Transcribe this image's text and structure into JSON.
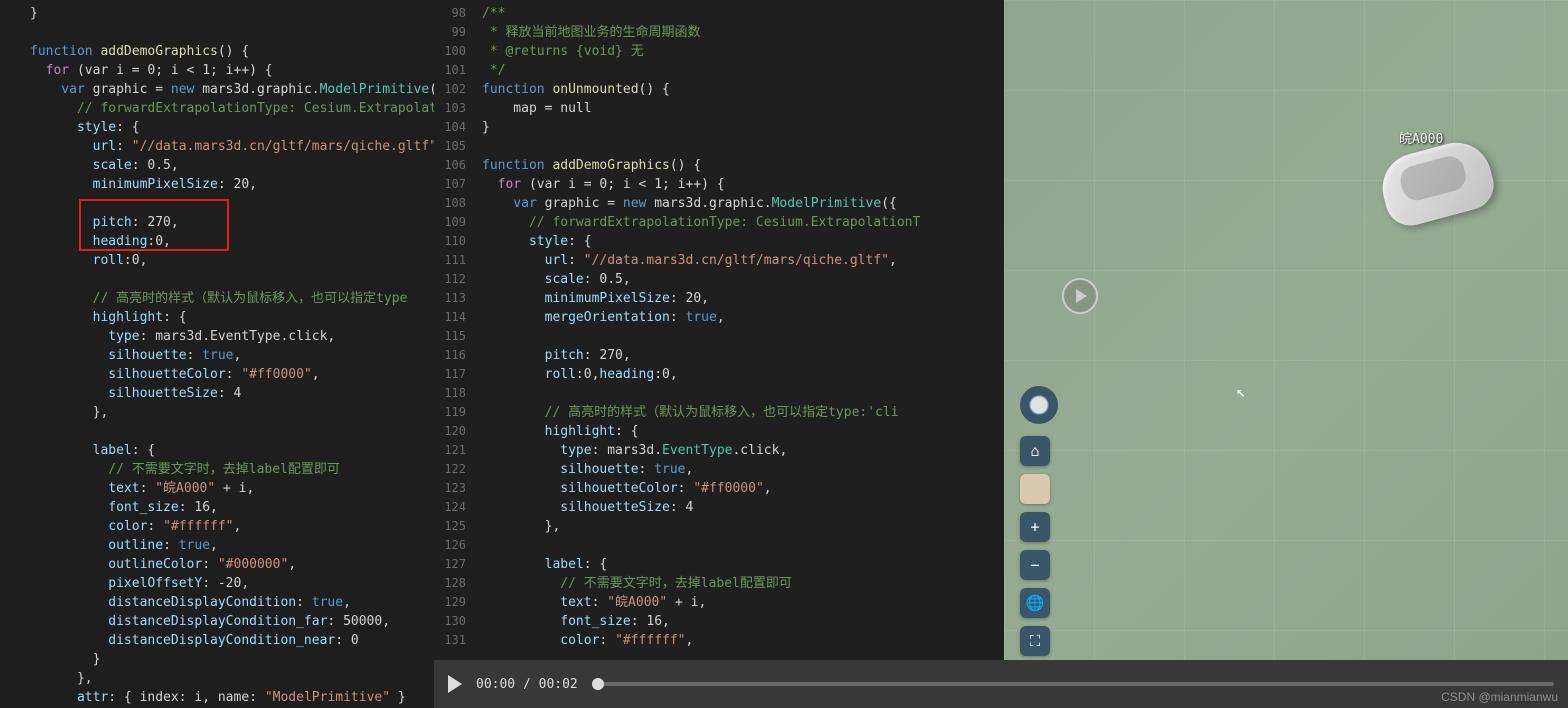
{
  "leftCode": {
    "l1": "}",
    "l2": "",
    "l3_kw": "function",
    "l3_fn": " addDemoGraphics",
    "l3_rest": "() {",
    "l4_for": "  for",
    "l4_rest": " (var i = 0; i < 1; i++) {",
    "l5_var": "    var",
    "l5_g": " graphic = ",
    "l5_new": "new",
    "l5_m": " mars3d.graphic.",
    "l5_t": "ModelPrimitive",
    "l5_p": "(",
    "l6": "      // forwardExtrapolationType: Cesium.Extrapolat",
    "l7_p": "      style",
    "l7_r": ": {",
    "l8_p": "        url",
    "l8_c": ": ",
    "l8_s": "\"//data.mars3d.cn/gltf/mars/qiche.gltf\"",
    "l9_p": "        scale",
    "l9_r": ": 0.5,",
    "l10_p": "        minimumPixelSize",
    "l10_r": ": 20,",
    "l11": "",
    "l12_p": "        pitch",
    "l12_r": ": 270,",
    "l13_p": "        heading",
    "l13_r": ":0,",
    "l14_p": "        roll",
    "l14_r": ":0,",
    "l15": "",
    "l16": "        // 高亮时的样式（默认为鼠标移入，也可以指定type",
    "l17_p": "        highlight",
    "l17_r": ": {",
    "l18_p": "          type",
    "l18_r": ": mars3d.EventType.click,",
    "l19_p": "          silhouette",
    "l19_c": ": ",
    "l19_v": "true",
    "l19_e": ",",
    "l20_p": "          silhouetteColor",
    "l20_c": ": ",
    "l20_s": "\"#ff0000\"",
    "l20_e": ",",
    "l21_p": "          silhouetteSize",
    "l21_r": ": 4",
    "l22": "        },",
    "l23": "",
    "l24_p": "        label",
    "l24_r": ": {",
    "l25": "          // 不需要文字时，去掉label配置即可",
    "l26_p": "          text",
    "l26_c": ": ",
    "l26_s": "\"皖A000\"",
    "l26_r": " + i,",
    "l27_p": "          font_size",
    "l27_r": ": 16,",
    "l28_p": "          color",
    "l28_c": ": ",
    "l28_s": "\"#ffffff\"",
    "l28_e": ",",
    "l29_p": "          outline",
    "l29_c": ": ",
    "l29_v": "true",
    "l29_e": ",",
    "l30_p": "          outlineColor",
    "l30_c": ": ",
    "l30_s": "\"#000000\"",
    "l30_e": ",",
    "l31_p": "          pixelOffsetY",
    "l31_r": ": -20,",
    "l32_p": "          distanceDisplayCondition",
    "l32_c": ": ",
    "l32_v": "true",
    "l32_e": ",",
    "l33_p": "          distanceDisplayCondition_far",
    "l33_r": ": 50000,",
    "l34_p": "          distanceDisplayCondition_near",
    "l34_r": ": 0",
    "l35": "        }",
    "l36": "      },",
    "l37_p": "      attr",
    "l37_r": ": { index: i, name: ",
    "l37_s": "\"ModelPrimitive\"",
    "l37_e": " }"
  },
  "lineNumbers": [
    "98",
    "99",
    "100",
    "101",
    "102",
    "103",
    "104",
    "105",
    "106",
    "107",
    "108",
    "109",
    "110",
    "111",
    "112",
    "113",
    "114",
    "115",
    "116",
    "117",
    "118",
    "119",
    "120",
    "121",
    "122",
    "123",
    "124",
    "125",
    "126",
    "127",
    "128",
    "129",
    "130",
    "131"
  ],
  "rightCode": {
    "r1": "/**",
    "r2": " * 释放当前地图业务的生命周期函数",
    "r3": " * @returns {void} 无",
    "r4": " */",
    "r5_k": "function",
    "r5_f": " onUnmounted",
    "r5_r": "() {",
    "r6": "    map = null",
    "r7": "}",
    "r8": "",
    "r9_k": "function",
    "r9_f": " addDemoGraphics",
    "r9_r": "() {",
    "r10_f": "  for",
    "r10_r": " (var i = 0; i < 1; i++) {",
    "r11_v": "    var",
    "r11_g": " graphic = ",
    "r11_n": "new",
    "r11_m": " mars3d.graphic.",
    "r11_t": "ModelPrimitive",
    "r11_p": "({",
    "r12": "      // forwardExtrapolationType: Cesium.ExtrapolationT",
    "r13_p": "      style",
    "r13_r": ": {",
    "r14_p": "        url",
    "r14_c": ": ",
    "r14_s": "\"//data.mars3d.cn/gltf/mars/qiche.gltf\"",
    "r14_e": ",",
    "r15_p": "        scale",
    "r15_r": ": 0.5,",
    "r16_p": "        minimumPixelSize",
    "r16_r": ": 20,",
    "r17_p": "        mergeOrientation",
    "r17_c": ": ",
    "r17_v": "true",
    "r17_e": ",",
    "r18": "",
    "r19_p": "        pitch",
    "r19_r": ": 270,",
    "r20_p": "        roll",
    "r20_r": ":0,",
    "r20_p2": "heading",
    "r20_r2": ":0,",
    "r21": "",
    "r22": "        // 高亮时的样式（默认为鼠标移入，也可以指定type:'cli",
    "r23_p": "        highlight",
    "r23_r": ": {",
    "r24_p": "          type",
    "r24_r": ": mars3d.",
    "r24_t": "EventType",
    "r24_e": ".click,",
    "r25_p": "          silhouette",
    "r25_c": ": ",
    "r25_v": "true",
    "r25_e": ",",
    "r26_p": "          silhouetteColor",
    "r26_c": ": ",
    "r26_s": "\"#ff0000\"",
    "r26_e": ",",
    "r27_p": "          silhouetteSize",
    "r27_r": ": 4",
    "r28": "        },",
    "r29": "",
    "r30_p": "        label",
    "r30_r": ": {",
    "r31": "          // 不需要文字时，去掉label配置即可",
    "r32_p": "          text",
    "r32_c": ": ",
    "r32_s": "\"皖A000\"",
    "r32_r": " + i,",
    "r33_p": "          font_size",
    "r33_r": ": 16,",
    "r34_p": "          color",
    "r34_c": ": ",
    "r34_s": "\"#ffffff\"",
    "r34_e": ","
  },
  "video": {
    "time": "00:00 / 00:02"
  },
  "map": {
    "carLabel": "皖A000"
  },
  "controls": {
    "home": "⌂",
    "plus": "+",
    "minus": "−",
    "globe": "🌐",
    "full": "⛶"
  },
  "watermark": "CSDN @mianmianwu"
}
